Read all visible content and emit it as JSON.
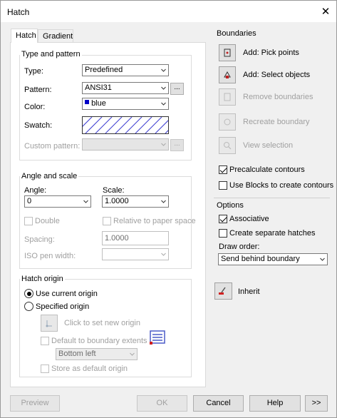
{
  "window": {
    "title": "Hatch",
    "close": "✕"
  },
  "tabs": {
    "hatch": "Hatch",
    "gradient": "Gradient"
  },
  "type_pattern": {
    "title": "Type and pattern",
    "type_label": "Type:",
    "type_value": "Predefined",
    "pattern_label": "Pattern:",
    "pattern_value": "ANSI31",
    "pattern_browse": "...",
    "color_label": "Color:",
    "color_value": "blue",
    "color_swatch": "#0000c8",
    "swatch_label": "Swatch:",
    "custom_label": "Custom pattern:",
    "custom_browse": "..."
  },
  "angle_scale": {
    "title": "Angle and scale",
    "angle_label": "Angle:",
    "angle_value": "0",
    "scale_label": "Scale:",
    "scale_value": "1.0000",
    "double_label": "Double",
    "relative_label": "Relative to paper space",
    "spacing_label": "Spacing:",
    "spacing_value": "1.0000",
    "iso_label": "ISO pen width:"
  },
  "hatch_origin": {
    "title": "Hatch origin",
    "use_current": "Use current origin",
    "specified": "Specified origin",
    "click_set": "Click to set new origin",
    "default_boundary": "Default to boundary extents",
    "position_value": "Bottom left",
    "store_default": "Store as default origin"
  },
  "boundaries": {
    "title": "Boundaries",
    "add_pick": "Add: Pick points",
    "add_select": "Add: Select objects",
    "remove": "Remove boundaries",
    "recreate": "Recreate boundary",
    "view_selection": "View selection",
    "precalculate": "Precalculate contours",
    "use_blocks": "Use Blocks to create contours"
  },
  "options": {
    "title": "Options",
    "associative": "Associative",
    "separate": "Create separate hatches",
    "draw_order_label": "Draw order:",
    "draw_order_value": "Send behind boundary"
  },
  "inherit": {
    "label": "Inherit"
  },
  "footer": {
    "preview": "Preview",
    "ok": "OK",
    "cancel": "Cancel",
    "help": "Help",
    "more": ">>"
  },
  "colors": {
    "accent": "#0078d7",
    "hatch_line": "#3a3ad0",
    "disabled": "#a0a0a0"
  }
}
